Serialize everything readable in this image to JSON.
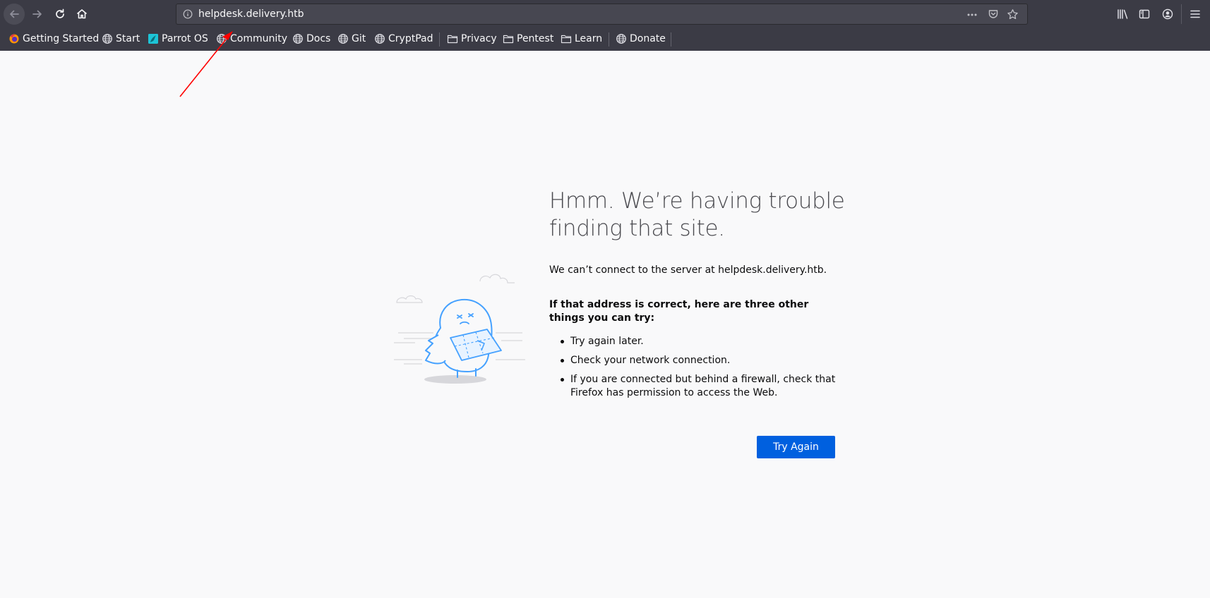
{
  "browser": {
    "url": "helpdesk.delivery.htb",
    "bookmarks": [
      {
        "label": "Getting Started",
        "icon": "firefox-icon"
      },
      {
        "label": "Start",
        "icon": "globe-icon"
      },
      {
        "label": "Parrot OS",
        "icon": "parrot-icon"
      },
      {
        "label": "Community",
        "icon": "globe-icon"
      },
      {
        "label": "Docs",
        "icon": "globe-icon"
      },
      {
        "label": "Git",
        "icon": "globe-icon"
      },
      {
        "label": "CryptPad",
        "icon": "globe-icon"
      },
      {
        "label": "Privacy",
        "icon": "folder-icon"
      },
      {
        "label": "Pentest",
        "icon": "folder-icon"
      },
      {
        "label": "Learn",
        "icon": "folder-icon"
      },
      {
        "label": "Donate",
        "icon": "globe-icon"
      }
    ]
  },
  "error_page": {
    "title": "Hmm. We’re having trouble finding that site.",
    "description": "We can’t connect to the server at helpdesk.delivery.htb.",
    "hint": "If that address is correct, here are three other things you can try:",
    "suggestions": [
      "Try again later.",
      "Check your network connection.",
      "If you are connected but behind a firewall, check that Firefox has permission to access the Web."
    ],
    "button_label": "Try Again"
  },
  "colors": {
    "chrome_bg": "#3b3b45",
    "page_bg": "#f9f9fa",
    "button_blue": "#0060df",
    "annotation_arrow": "#ff0000"
  }
}
